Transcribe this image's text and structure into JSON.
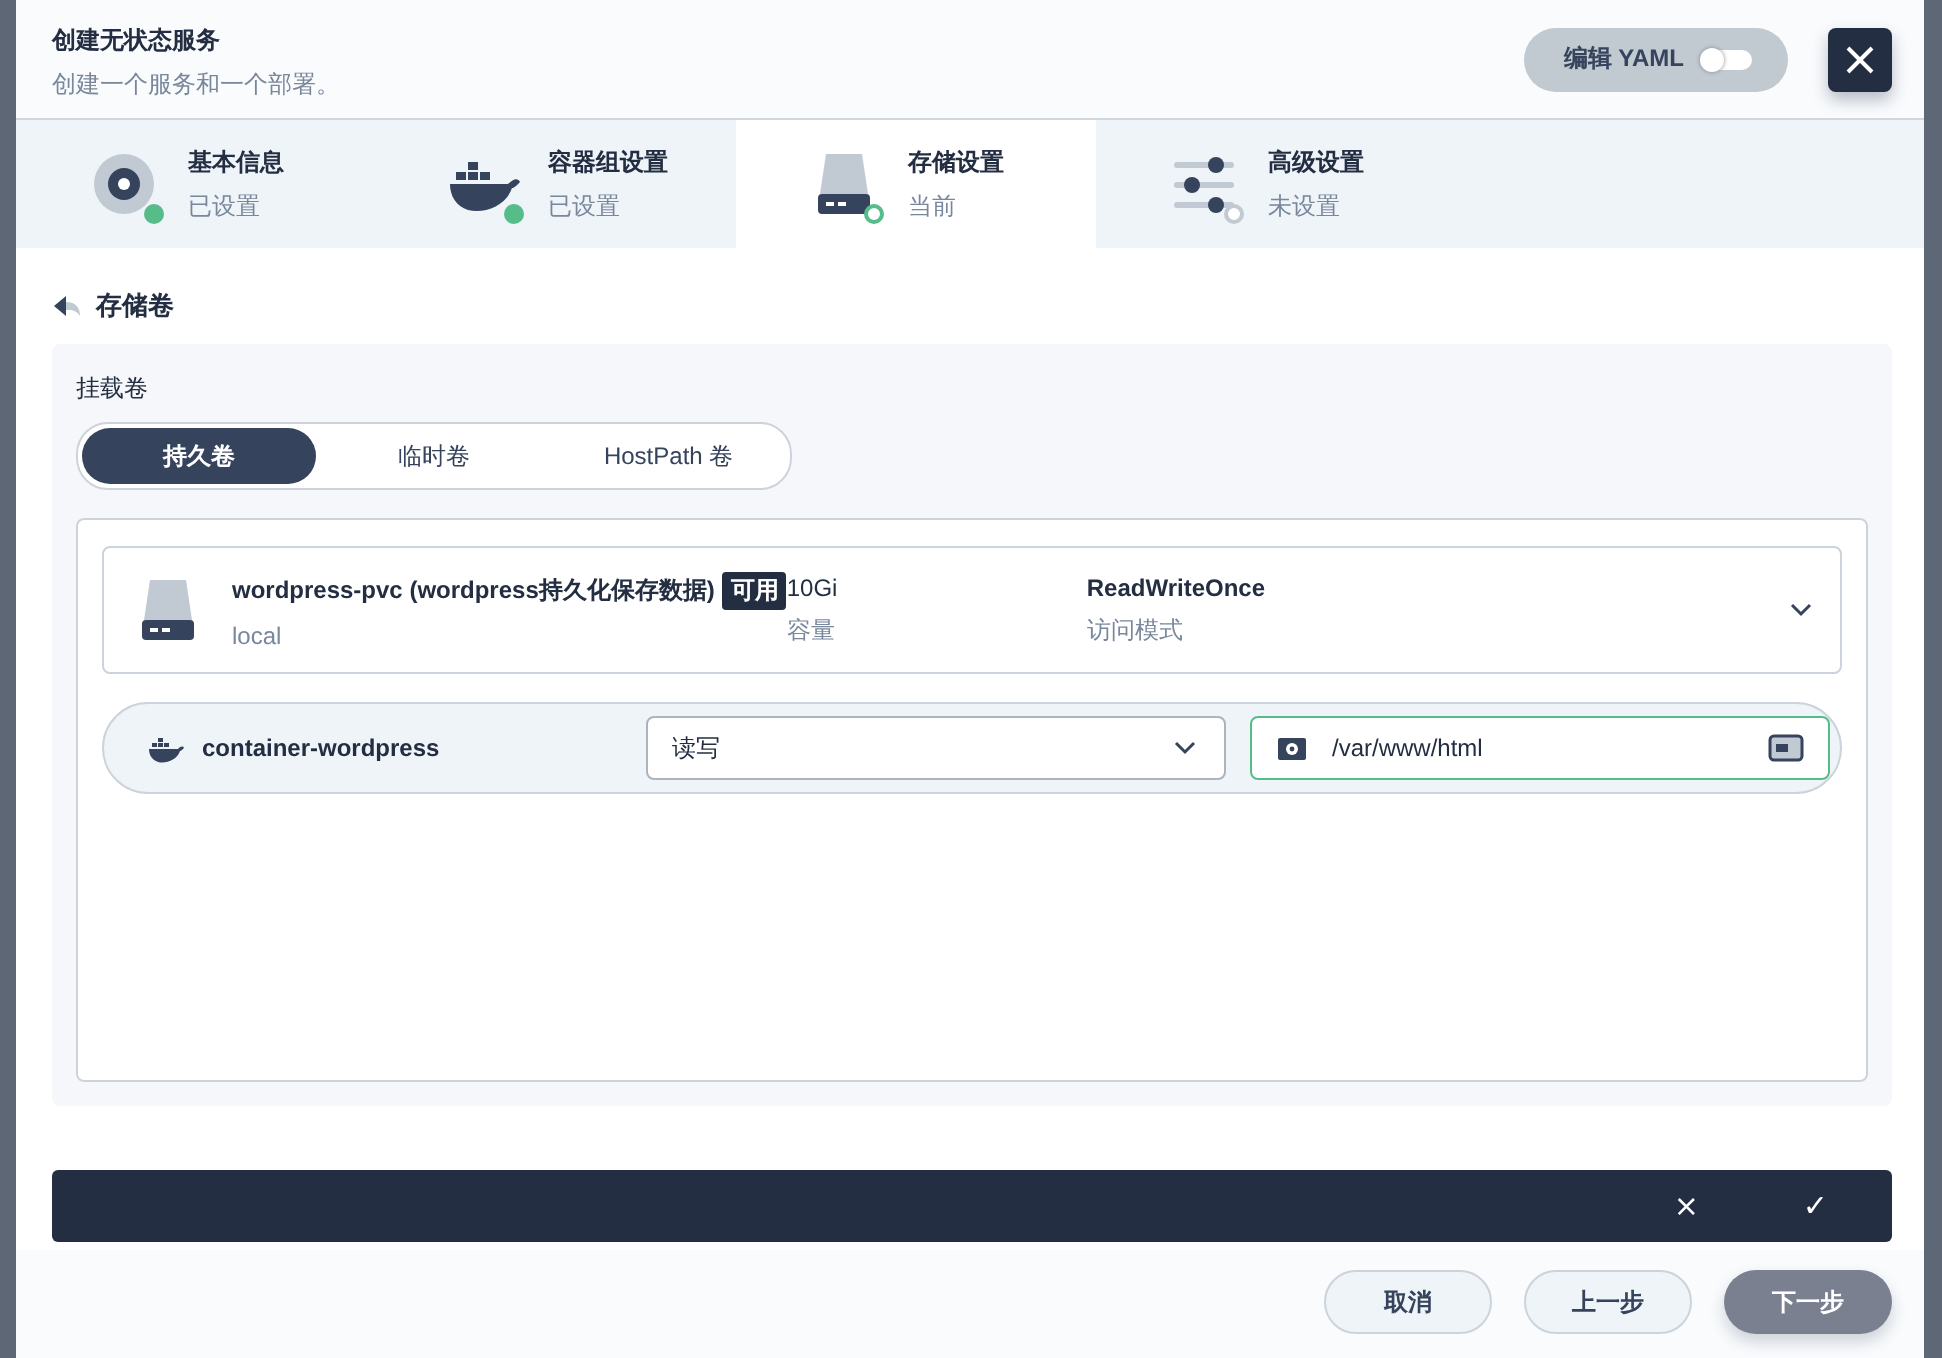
{
  "dialog": {
    "title": "创建无状态服务",
    "subtitle": "创建一个服务和一个部署。"
  },
  "yaml_toggle": {
    "label": "编辑 YAML",
    "on": false
  },
  "steps": [
    {
      "kind": "disc",
      "title": "基本信息",
      "status": "已设置",
      "selected": false,
      "done": true
    },
    {
      "kind": "whale",
      "title": "容器组设置",
      "status": "已设置",
      "selected": false,
      "done": true
    },
    {
      "kind": "drive",
      "title": "存储设置",
      "status": "当前",
      "selected": true,
      "done": false
    },
    {
      "kind": "sliders",
      "title": "高级设置",
      "status": "未设置",
      "selected": false,
      "done": false
    }
  ],
  "section_title": "存储卷",
  "mount": {
    "label": "挂载卷",
    "tabs": [
      {
        "label": "持久卷",
        "selected": true
      },
      {
        "label": "临时卷",
        "selected": false
      },
      {
        "label": "HostPath 卷",
        "selected": false
      }
    ]
  },
  "volume": {
    "name": "wordpress-pvc (wordpress持久化保存数据)",
    "badge": "可用",
    "storage_class": "local",
    "capacity": "10Gi",
    "capacity_label": "容量",
    "access_mode": "ReadWriteOnce",
    "access_label": "访问模式",
    "expanded": false
  },
  "container_mount": {
    "container": "container-wordpress",
    "mode": "读写",
    "path": "/var/www/html"
  },
  "action_bar": {
    "cancel": "×",
    "confirm": "✓"
  },
  "buttons": [
    {
      "label": "取消",
      "kind": "default"
    },
    {
      "label": "上一步",
      "kind": "default"
    },
    {
      "label": "下一步",
      "kind": "primary"
    }
  ]
}
